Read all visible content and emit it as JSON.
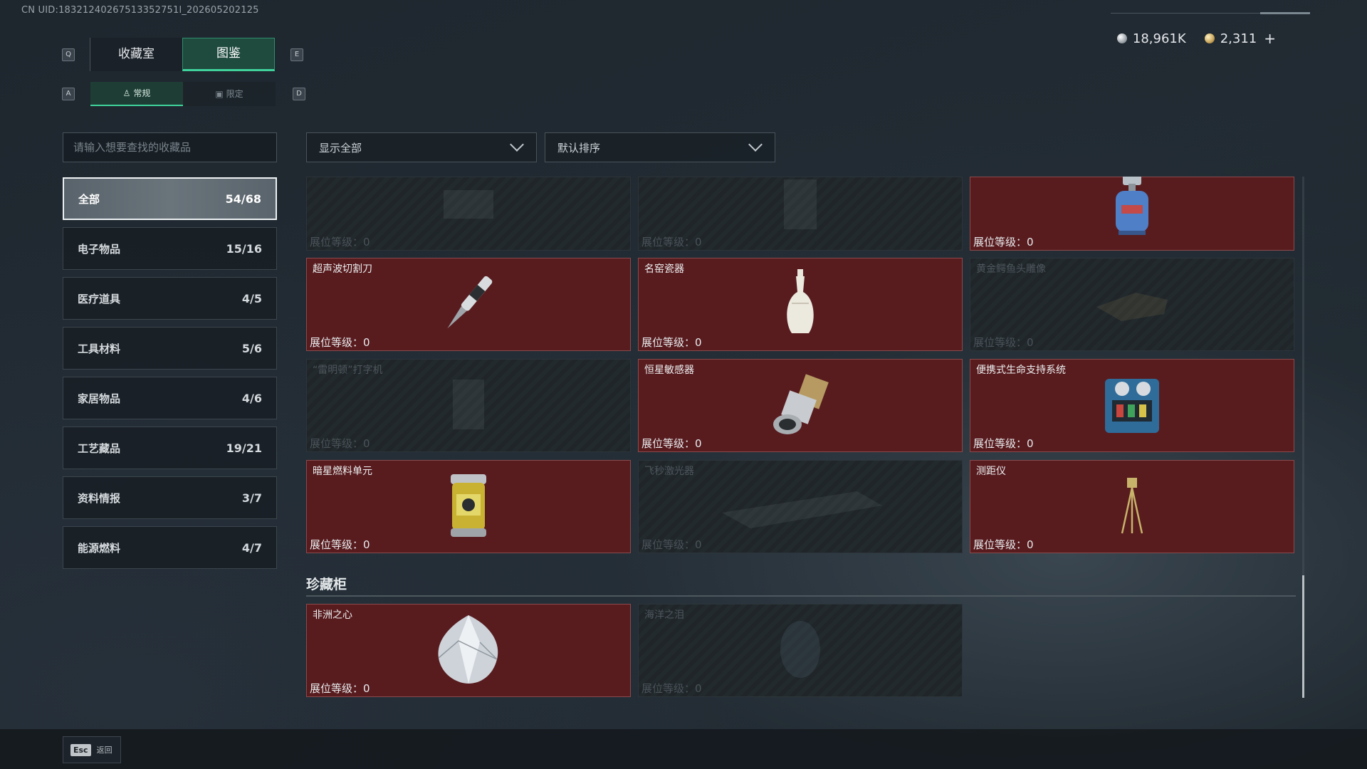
{
  "uid": "CN UID:18321240267513352751l_202605202125",
  "currency": {
    "silver": "18,961K",
    "gold": "2,311",
    "add_label": "+"
  },
  "keys": {
    "q": "Q",
    "e": "E",
    "a": "A",
    "d": "D"
  },
  "main_tabs": [
    {
      "label": "收藏室",
      "active": false
    },
    {
      "label": "图鉴",
      "active": true
    }
  ],
  "sub_tabs": [
    {
      "label": "常规",
      "active": true
    },
    {
      "label": "限定",
      "active": false
    }
  ],
  "search": {
    "placeholder": "请输入想要查找的收藏品"
  },
  "filters": {
    "show": "显示全部",
    "sort": "默认排序"
  },
  "categories": [
    {
      "label": "全部",
      "count": "54/68"
    },
    {
      "label": "电子物品",
      "count": "15/16"
    },
    {
      "label": "医疗道具",
      "count": "4/5"
    },
    {
      "label": "工具材料",
      "count": "5/6"
    },
    {
      "label": "家居物品",
      "count": "4/6"
    },
    {
      "label": "工艺藏品",
      "count": "19/21"
    },
    {
      "label": "资料情报",
      "count": "3/7"
    },
    {
      "label": "能源燃料",
      "count": "4/7"
    }
  ],
  "level_label": "展位等级：",
  "items": [
    {
      "name": "",
      "level": "0",
      "owned": false,
      "icon": "item-icon"
    },
    {
      "name": "",
      "level": "0",
      "owned": false,
      "icon": "item-icon"
    },
    {
      "name": "",
      "level": "0",
      "owned": true,
      "icon": "gas-canister-icon"
    },
    {
      "name": "超声波切割刀",
      "level": "0",
      "owned": true,
      "icon": "ultrasonic-cutter-icon"
    },
    {
      "name": "名窑瓷器",
      "level": "0",
      "owned": true,
      "icon": "porcelain-vase-icon"
    },
    {
      "name": "黄金鳄鱼头雕像",
      "level": "0",
      "owned": false,
      "icon": "crocodile-statue-icon"
    },
    {
      "name": "“雷明顿”打字机",
      "level": "0",
      "owned": false,
      "icon": "typewriter-icon"
    },
    {
      "name": "恒星敏感器",
      "level": "0",
      "owned": true,
      "icon": "star-sensor-icon"
    },
    {
      "name": "便携式生命支持系统",
      "level": "0",
      "owned": true,
      "icon": "life-support-icon"
    },
    {
      "name": "暗星燃料单元",
      "level": "0",
      "owned": true,
      "icon": "fuel-cell-icon"
    },
    {
      "name": "飞秒激光器",
      "level": "0",
      "owned": false,
      "icon": "laser-icon"
    },
    {
      "name": "测距仪",
      "level": "0",
      "owned": true,
      "icon": "rangefinder-icon"
    }
  ],
  "treasure": {
    "title": "珍藏柜",
    "items": [
      {
        "name": "非洲之心",
        "level": "0",
        "owned": true,
        "icon": "diamond-icon"
      },
      {
        "name": "海洋之泪",
        "level": "0",
        "owned": false,
        "icon": "gem-icon"
      }
    ]
  },
  "footer": {
    "esc_key": "Esc",
    "back_label": "返回"
  }
}
